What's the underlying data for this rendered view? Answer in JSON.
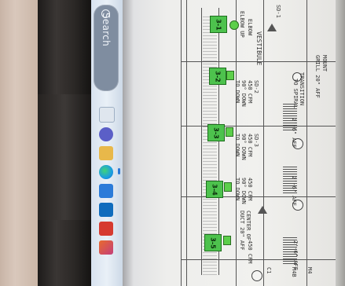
{
  "taskbar": {
    "search_label": "Search",
    "icons": [
      {
        "name": "file-explorer-icon",
        "color": "#e8b84a"
      },
      {
        "name": "teams-icon",
        "color": "#5b5fc7"
      },
      {
        "name": "mail-icon",
        "color": "#3a7bd5"
      },
      {
        "name": "edge-icon",
        "color": "#1b9de2"
      },
      {
        "name": "store-icon",
        "color": "#2b7bd9"
      },
      {
        "name": "outlook-icon",
        "color": "#0f6cbd"
      },
      {
        "name": "acrobat-icon",
        "color": "#d63a30"
      },
      {
        "name": "office-icon",
        "color": "#e86a2e"
      }
    ]
  },
  "drawing": {
    "tags": [
      {
        "id": "tag-3-1",
        "label": "3-1"
      },
      {
        "id": "tag-3-2",
        "label": "3-2"
      },
      {
        "id": "tag-3-3",
        "label": "3-3"
      },
      {
        "id": "tag-3-4",
        "label": "3-4"
      },
      {
        "id": "tag-3-5",
        "label": "3-5"
      }
    ],
    "notes": {
      "vestibule": "VESTIBULE",
      "transition": "TRANSITION",
      "to_spiral": "TO SPIRAL",
      "elbow": "ELBOW",
      "elbow_up": "ELBOW UP",
      "down_1": "90° DOWN",
      "down_2": "TO DOWN",
      "down_3": "90° DOWN",
      "down_4": "TO DOWN",
      "down_5": "90° DOWN",
      "down_6": "TO DOWN",
      "cfm_1": "450 CFM",
      "cfm_2": "450 CFM",
      "cfm_3": "450 CFM",
      "cfm_4": "450 CFM",
      "aff_1": "2'-6\" AFF",
      "aff_2": "2'-6\" AFF",
      "aff_3": "2'-6\" AFF",
      "grill": "GRILL 20\" AFF",
      "mount": "MOUNT",
      "duct": "DUCT 20\" AFF",
      "center": "CENTER OF",
      "sd_1": "SD-1",
      "sd_2": "SD-2",
      "sd_3": "SD-3",
      "m4": "M4",
      "m4b": "M4B",
      "c1": "C1"
    }
  }
}
